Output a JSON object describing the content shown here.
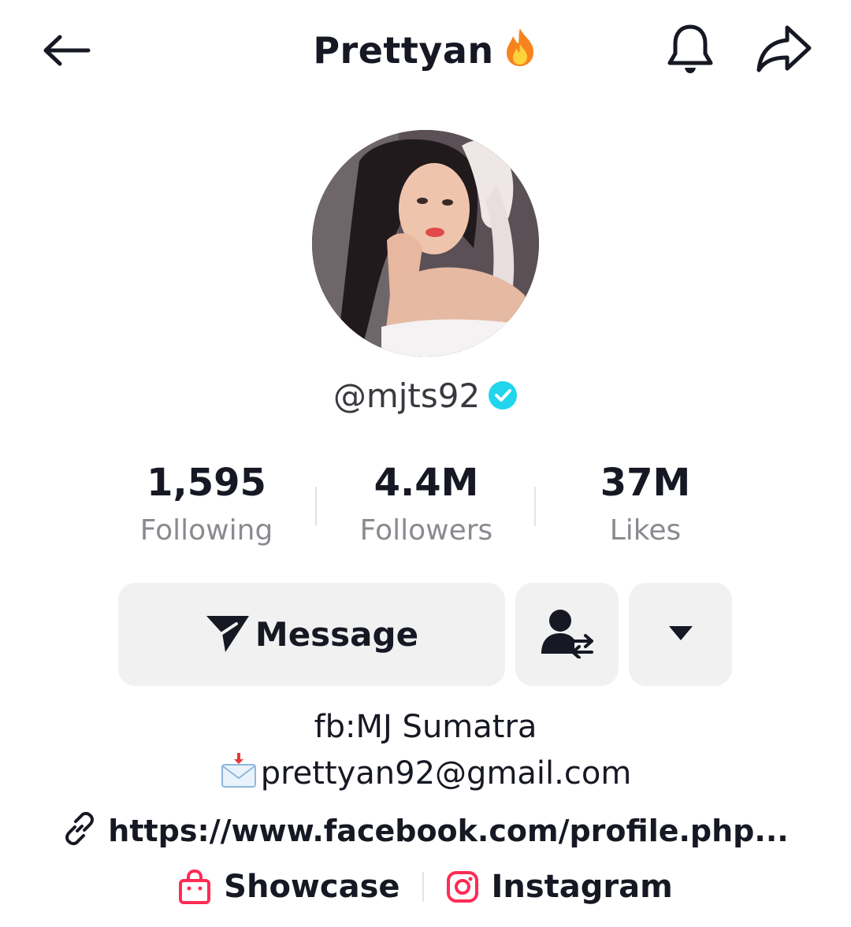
{
  "header": {
    "title": "Prettyan",
    "title_emoji": "🔥",
    "icons": {
      "back": "back-arrow-icon",
      "bell": "bell-icon",
      "share": "share-arrow-icon"
    }
  },
  "profile": {
    "avatar": "profile-photo",
    "username": "@mjts92",
    "verified": true,
    "verified_color": "#20d5ec"
  },
  "stats": [
    {
      "value": "1,595",
      "label": "Following"
    },
    {
      "value": "4.4M",
      "label": "Followers"
    },
    {
      "value": "37M",
      "label": "Likes"
    }
  ],
  "actions": {
    "message_label": "Message",
    "message_icon": "paper-plane-icon",
    "friend_icon": "user-swap-icon",
    "more_icon": "triangle-down-icon"
  },
  "bio": {
    "line1": "fb:MJ Sumatra",
    "line2_emoji": "📩",
    "line2_text": "prettyan92@gmail.com",
    "link": "https://www.facebook.com/profile.php..."
  },
  "social": {
    "showcase_label": "Showcase",
    "instagram_label": "Instagram",
    "accent_color": "#fe2c55"
  },
  "colors": {
    "text_primary": "#161823",
    "text_secondary": "#8a8b91",
    "button_bg": "#f1f1f2"
  }
}
